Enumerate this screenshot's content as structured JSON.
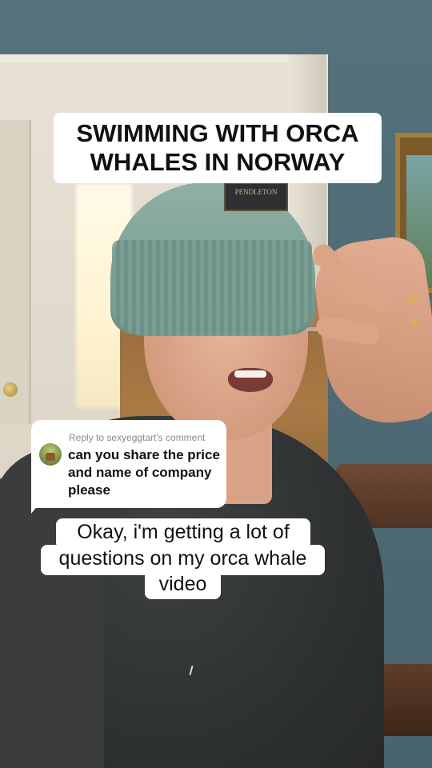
{
  "overlay_title": {
    "line1": "SWIMMING WITH ORCA",
    "line2": "WHALES IN NORWAY"
  },
  "reply": {
    "meta": "Reply to sexyeggtart's comment",
    "text": "can you share the price and name of company please"
  },
  "caption": {
    "line1": "Okay, i'm getting a lot of",
    "line2": "questions on my orca whale",
    "line3": "video"
  },
  "beanie_tag": "PENDLETON",
  "colors": {
    "overlay_bg": "#ffffff",
    "overlay_text": "#111111",
    "reply_meta": "#8a8a8a"
  }
}
